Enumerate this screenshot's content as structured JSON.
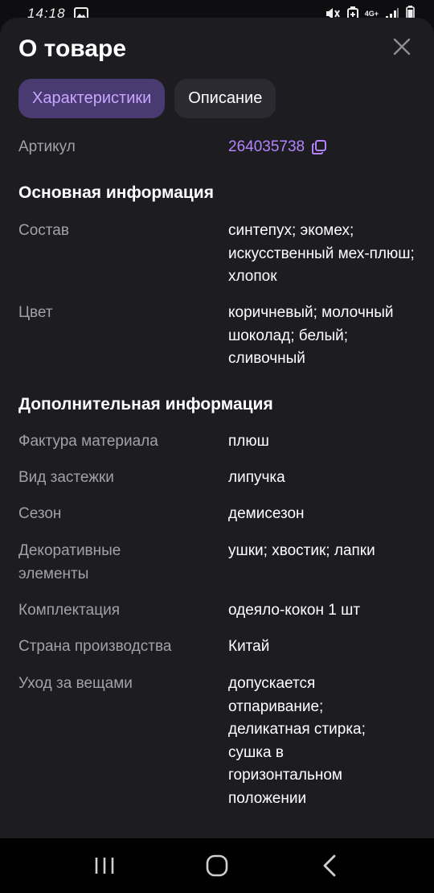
{
  "status_bar": {
    "time": "14:18",
    "network": "4G+",
    "icons": [
      "image-icon",
      "mute-icon",
      "battery-saver-icon",
      "signal-icon",
      "battery-icon"
    ]
  },
  "sheet": {
    "title": "О товаре",
    "tabs": [
      {
        "label": "Характеристики",
        "active": true
      },
      {
        "label": "Описание",
        "active": false
      }
    ],
    "article": {
      "label": "Артикул",
      "value": "264035738"
    },
    "sections": [
      {
        "title": "Основная информация",
        "rows": [
          {
            "label": "Состав",
            "value": "синтепух; экомех; искусственный мех-плюш; хлопок"
          },
          {
            "label": "Цвет",
            "value": "коричневый; молочный шоколад; белый; сливочный"
          }
        ]
      },
      {
        "title": "Дополнительная информация",
        "rows": [
          {
            "label": "Фактура материала",
            "value": "плюш"
          },
          {
            "label": "Вид застежки",
            "value": "липучка"
          },
          {
            "label": "Сезон",
            "value": "демисезон"
          },
          {
            "label": "Декоративные элементы",
            "value": "ушки; хвостик; лапки"
          },
          {
            "label": "Комплектация",
            "value": "одеяло-кокон 1 шт"
          },
          {
            "label": "Страна производства",
            "value": "Китай"
          },
          {
            "label": "Уход за вещами",
            "value": "допускается отпаривание; деликатная стирка; сушка в горизонтальном положении"
          }
        ]
      }
    ]
  },
  "nav_bar": {
    "icons": [
      "recent-apps-icon",
      "home-icon",
      "back-icon"
    ]
  },
  "colors": {
    "accent": "#b484ff",
    "active_tab_bg": "#4a3a72",
    "sheet_bg": "#1d1c21",
    "label_text": "#a2a1a8"
  }
}
